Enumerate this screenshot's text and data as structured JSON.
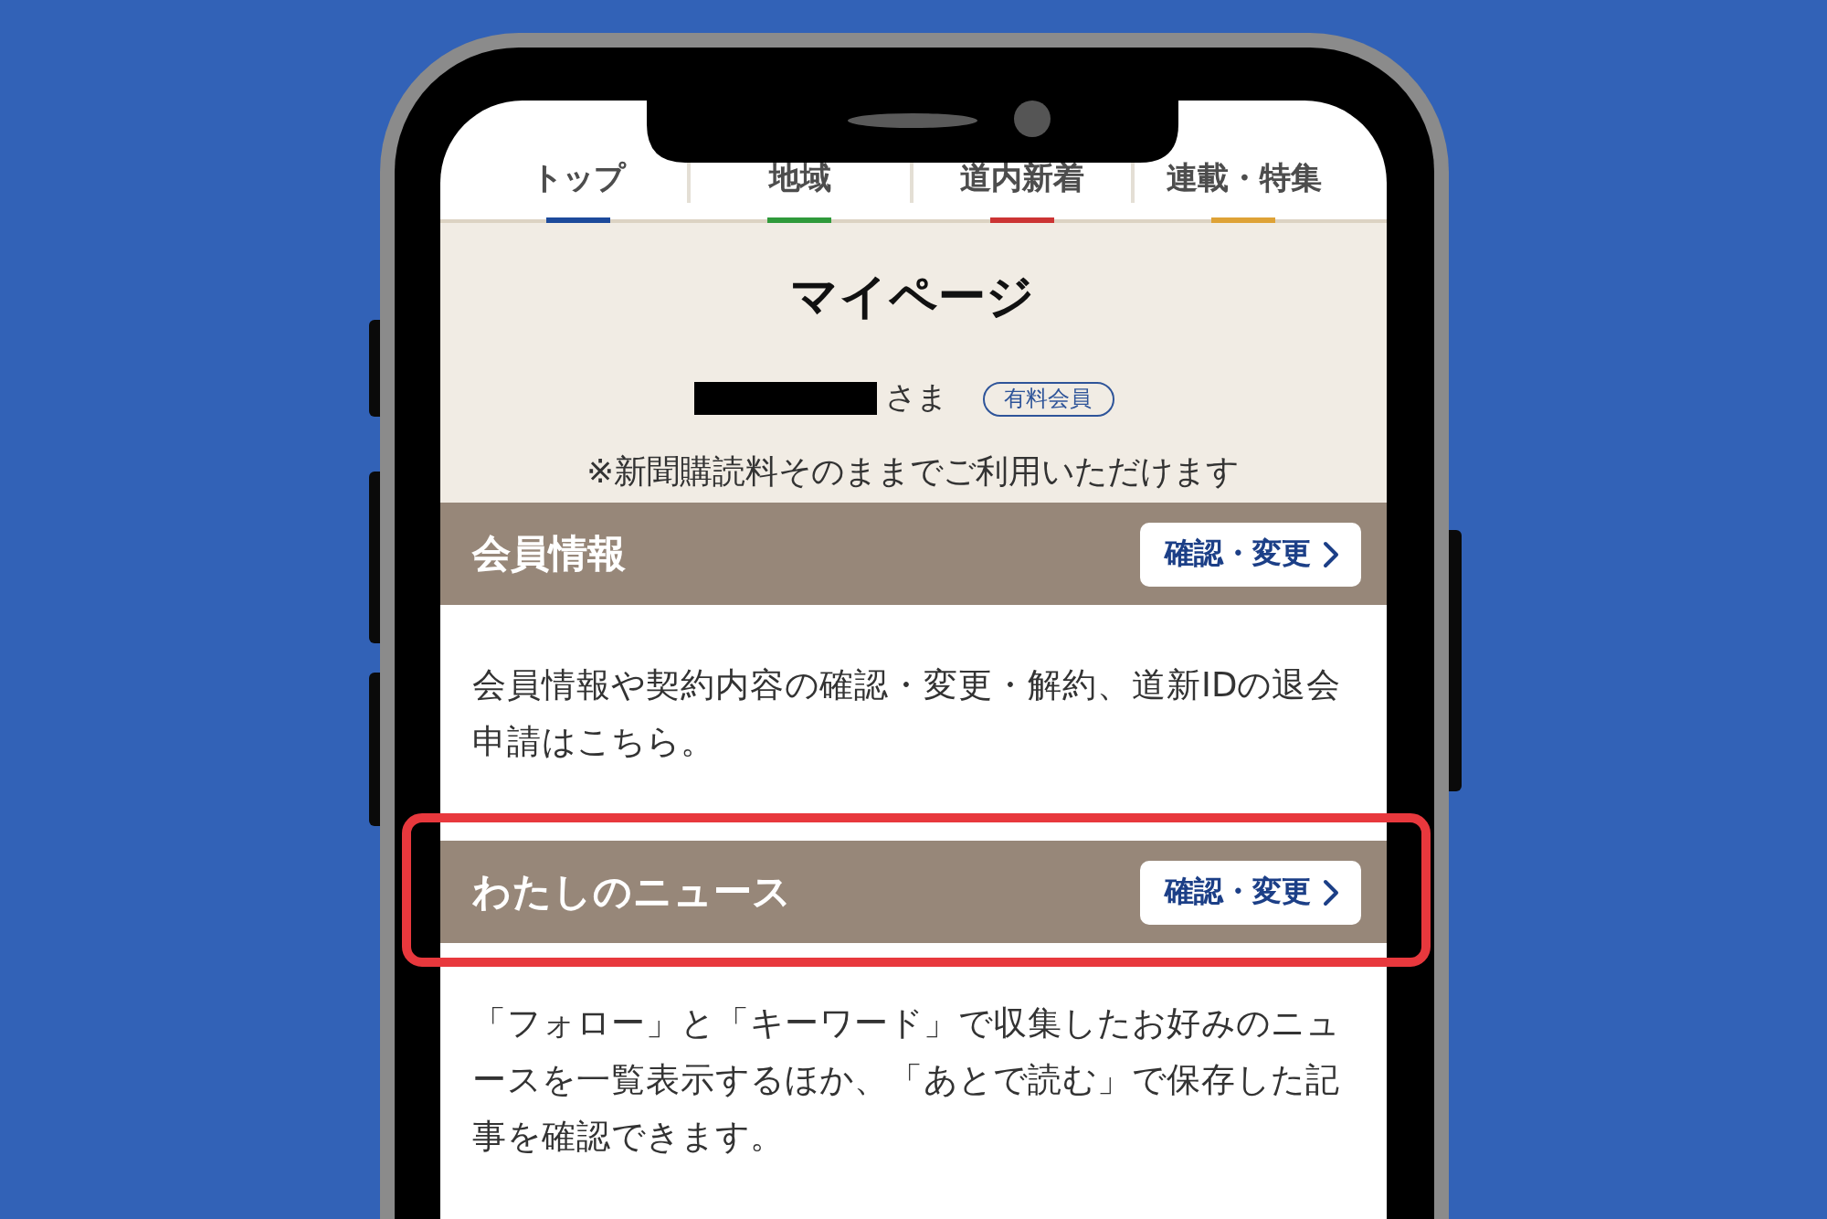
{
  "tabs": [
    {
      "label": "トップ",
      "color": "#1d4a9b"
    },
    {
      "label": "地域",
      "color": "#2f9a3b"
    },
    {
      "label": "道内新着",
      "color": "#cc3434"
    },
    {
      "label": "連載・特集",
      "color": "#dea236"
    }
  ],
  "page_title": "マイページ",
  "member": {
    "name_redacted": true,
    "honorific": "さま",
    "badge": "有料会員"
  },
  "note": "※新聞購読料そのままでご利用いただけます",
  "sections": [
    {
      "title": "会員情報",
      "button": "確認・変更",
      "description": "会員情報や契約内容の確認・変更・解約、道新IDの退会申請はこちら。",
      "highlighted": false
    },
    {
      "title": "わたしのニュース",
      "button": "確認・変更",
      "description": "「フォロー」と「キーワード」で収集したお好みのニュースを一覧表示するほか、「あとで読む」で保存した記事を確認できます。",
      "highlighted": true
    }
  ]
}
